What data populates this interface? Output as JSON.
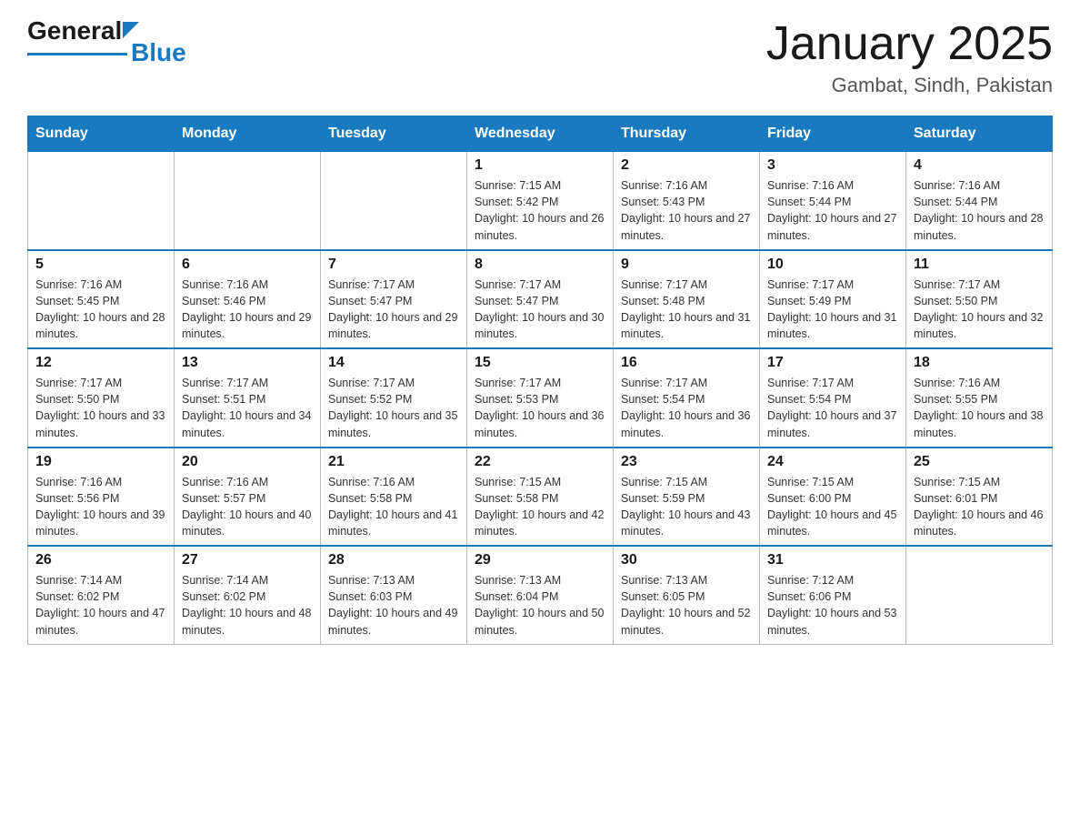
{
  "header": {
    "logo_general": "General",
    "logo_blue": "Blue",
    "month_title": "January 2025",
    "location": "Gambat, Sindh, Pakistan"
  },
  "weekdays": [
    "Sunday",
    "Monday",
    "Tuesday",
    "Wednesday",
    "Thursday",
    "Friday",
    "Saturday"
  ],
  "weeks": [
    [
      {
        "day": "",
        "sunrise": "",
        "sunset": "",
        "daylight": ""
      },
      {
        "day": "",
        "sunrise": "",
        "sunset": "",
        "daylight": ""
      },
      {
        "day": "",
        "sunrise": "",
        "sunset": "",
        "daylight": ""
      },
      {
        "day": "1",
        "sunrise": "Sunrise: 7:15 AM",
        "sunset": "Sunset: 5:42 PM",
        "daylight": "Daylight: 10 hours and 26 minutes."
      },
      {
        "day": "2",
        "sunrise": "Sunrise: 7:16 AM",
        "sunset": "Sunset: 5:43 PM",
        "daylight": "Daylight: 10 hours and 27 minutes."
      },
      {
        "day": "3",
        "sunrise": "Sunrise: 7:16 AM",
        "sunset": "Sunset: 5:44 PM",
        "daylight": "Daylight: 10 hours and 27 minutes."
      },
      {
        "day": "4",
        "sunrise": "Sunrise: 7:16 AM",
        "sunset": "Sunset: 5:44 PM",
        "daylight": "Daylight: 10 hours and 28 minutes."
      }
    ],
    [
      {
        "day": "5",
        "sunrise": "Sunrise: 7:16 AM",
        "sunset": "Sunset: 5:45 PM",
        "daylight": "Daylight: 10 hours and 28 minutes."
      },
      {
        "day": "6",
        "sunrise": "Sunrise: 7:16 AM",
        "sunset": "Sunset: 5:46 PM",
        "daylight": "Daylight: 10 hours and 29 minutes."
      },
      {
        "day": "7",
        "sunrise": "Sunrise: 7:17 AM",
        "sunset": "Sunset: 5:47 PM",
        "daylight": "Daylight: 10 hours and 29 minutes."
      },
      {
        "day": "8",
        "sunrise": "Sunrise: 7:17 AM",
        "sunset": "Sunset: 5:47 PM",
        "daylight": "Daylight: 10 hours and 30 minutes."
      },
      {
        "day": "9",
        "sunrise": "Sunrise: 7:17 AM",
        "sunset": "Sunset: 5:48 PM",
        "daylight": "Daylight: 10 hours and 31 minutes."
      },
      {
        "day": "10",
        "sunrise": "Sunrise: 7:17 AM",
        "sunset": "Sunset: 5:49 PM",
        "daylight": "Daylight: 10 hours and 31 minutes."
      },
      {
        "day": "11",
        "sunrise": "Sunrise: 7:17 AM",
        "sunset": "Sunset: 5:50 PM",
        "daylight": "Daylight: 10 hours and 32 minutes."
      }
    ],
    [
      {
        "day": "12",
        "sunrise": "Sunrise: 7:17 AM",
        "sunset": "Sunset: 5:50 PM",
        "daylight": "Daylight: 10 hours and 33 minutes."
      },
      {
        "day": "13",
        "sunrise": "Sunrise: 7:17 AM",
        "sunset": "Sunset: 5:51 PM",
        "daylight": "Daylight: 10 hours and 34 minutes."
      },
      {
        "day": "14",
        "sunrise": "Sunrise: 7:17 AM",
        "sunset": "Sunset: 5:52 PM",
        "daylight": "Daylight: 10 hours and 35 minutes."
      },
      {
        "day": "15",
        "sunrise": "Sunrise: 7:17 AM",
        "sunset": "Sunset: 5:53 PM",
        "daylight": "Daylight: 10 hours and 36 minutes."
      },
      {
        "day": "16",
        "sunrise": "Sunrise: 7:17 AM",
        "sunset": "Sunset: 5:54 PM",
        "daylight": "Daylight: 10 hours and 36 minutes."
      },
      {
        "day": "17",
        "sunrise": "Sunrise: 7:17 AM",
        "sunset": "Sunset: 5:54 PM",
        "daylight": "Daylight: 10 hours and 37 minutes."
      },
      {
        "day": "18",
        "sunrise": "Sunrise: 7:16 AM",
        "sunset": "Sunset: 5:55 PM",
        "daylight": "Daylight: 10 hours and 38 minutes."
      }
    ],
    [
      {
        "day": "19",
        "sunrise": "Sunrise: 7:16 AM",
        "sunset": "Sunset: 5:56 PM",
        "daylight": "Daylight: 10 hours and 39 minutes."
      },
      {
        "day": "20",
        "sunrise": "Sunrise: 7:16 AM",
        "sunset": "Sunset: 5:57 PM",
        "daylight": "Daylight: 10 hours and 40 minutes."
      },
      {
        "day": "21",
        "sunrise": "Sunrise: 7:16 AM",
        "sunset": "Sunset: 5:58 PM",
        "daylight": "Daylight: 10 hours and 41 minutes."
      },
      {
        "day": "22",
        "sunrise": "Sunrise: 7:15 AM",
        "sunset": "Sunset: 5:58 PM",
        "daylight": "Daylight: 10 hours and 42 minutes."
      },
      {
        "day": "23",
        "sunrise": "Sunrise: 7:15 AM",
        "sunset": "Sunset: 5:59 PM",
        "daylight": "Daylight: 10 hours and 43 minutes."
      },
      {
        "day": "24",
        "sunrise": "Sunrise: 7:15 AM",
        "sunset": "Sunset: 6:00 PM",
        "daylight": "Daylight: 10 hours and 45 minutes."
      },
      {
        "day": "25",
        "sunrise": "Sunrise: 7:15 AM",
        "sunset": "Sunset: 6:01 PM",
        "daylight": "Daylight: 10 hours and 46 minutes."
      }
    ],
    [
      {
        "day": "26",
        "sunrise": "Sunrise: 7:14 AM",
        "sunset": "Sunset: 6:02 PM",
        "daylight": "Daylight: 10 hours and 47 minutes."
      },
      {
        "day": "27",
        "sunrise": "Sunrise: 7:14 AM",
        "sunset": "Sunset: 6:02 PM",
        "daylight": "Daylight: 10 hours and 48 minutes."
      },
      {
        "day": "28",
        "sunrise": "Sunrise: 7:13 AM",
        "sunset": "Sunset: 6:03 PM",
        "daylight": "Daylight: 10 hours and 49 minutes."
      },
      {
        "day": "29",
        "sunrise": "Sunrise: 7:13 AM",
        "sunset": "Sunset: 6:04 PM",
        "daylight": "Daylight: 10 hours and 50 minutes."
      },
      {
        "day": "30",
        "sunrise": "Sunrise: 7:13 AM",
        "sunset": "Sunset: 6:05 PM",
        "daylight": "Daylight: 10 hours and 52 minutes."
      },
      {
        "day": "31",
        "sunrise": "Sunrise: 7:12 AM",
        "sunset": "Sunset: 6:06 PM",
        "daylight": "Daylight: 10 hours and 53 minutes."
      },
      {
        "day": "",
        "sunrise": "",
        "sunset": "",
        "daylight": ""
      }
    ]
  ]
}
